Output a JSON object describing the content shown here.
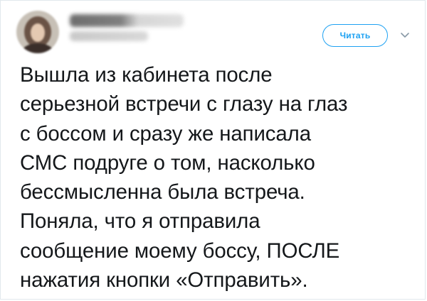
{
  "tweet": {
    "follow_label": "Читать",
    "lines": [
      "Вышла из кабинета после",
      "серьезной встречи с глазу на глаз",
      "с боссом и сразу же написала",
      "СМС подруге о том, насколько",
      "бессмысленна была встреча.",
      "Поняла, что я отправила",
      "сообщение моему боссу, ПОСЛЕ",
      "нажатия кнопки «Отправить»."
    ]
  },
  "icons": {
    "avatar": "avatar-photo",
    "menu": "chevron-down-icon"
  },
  "colors": {
    "accent": "#1da1f2",
    "text": "#14171a",
    "border": "#e1e8ed"
  }
}
